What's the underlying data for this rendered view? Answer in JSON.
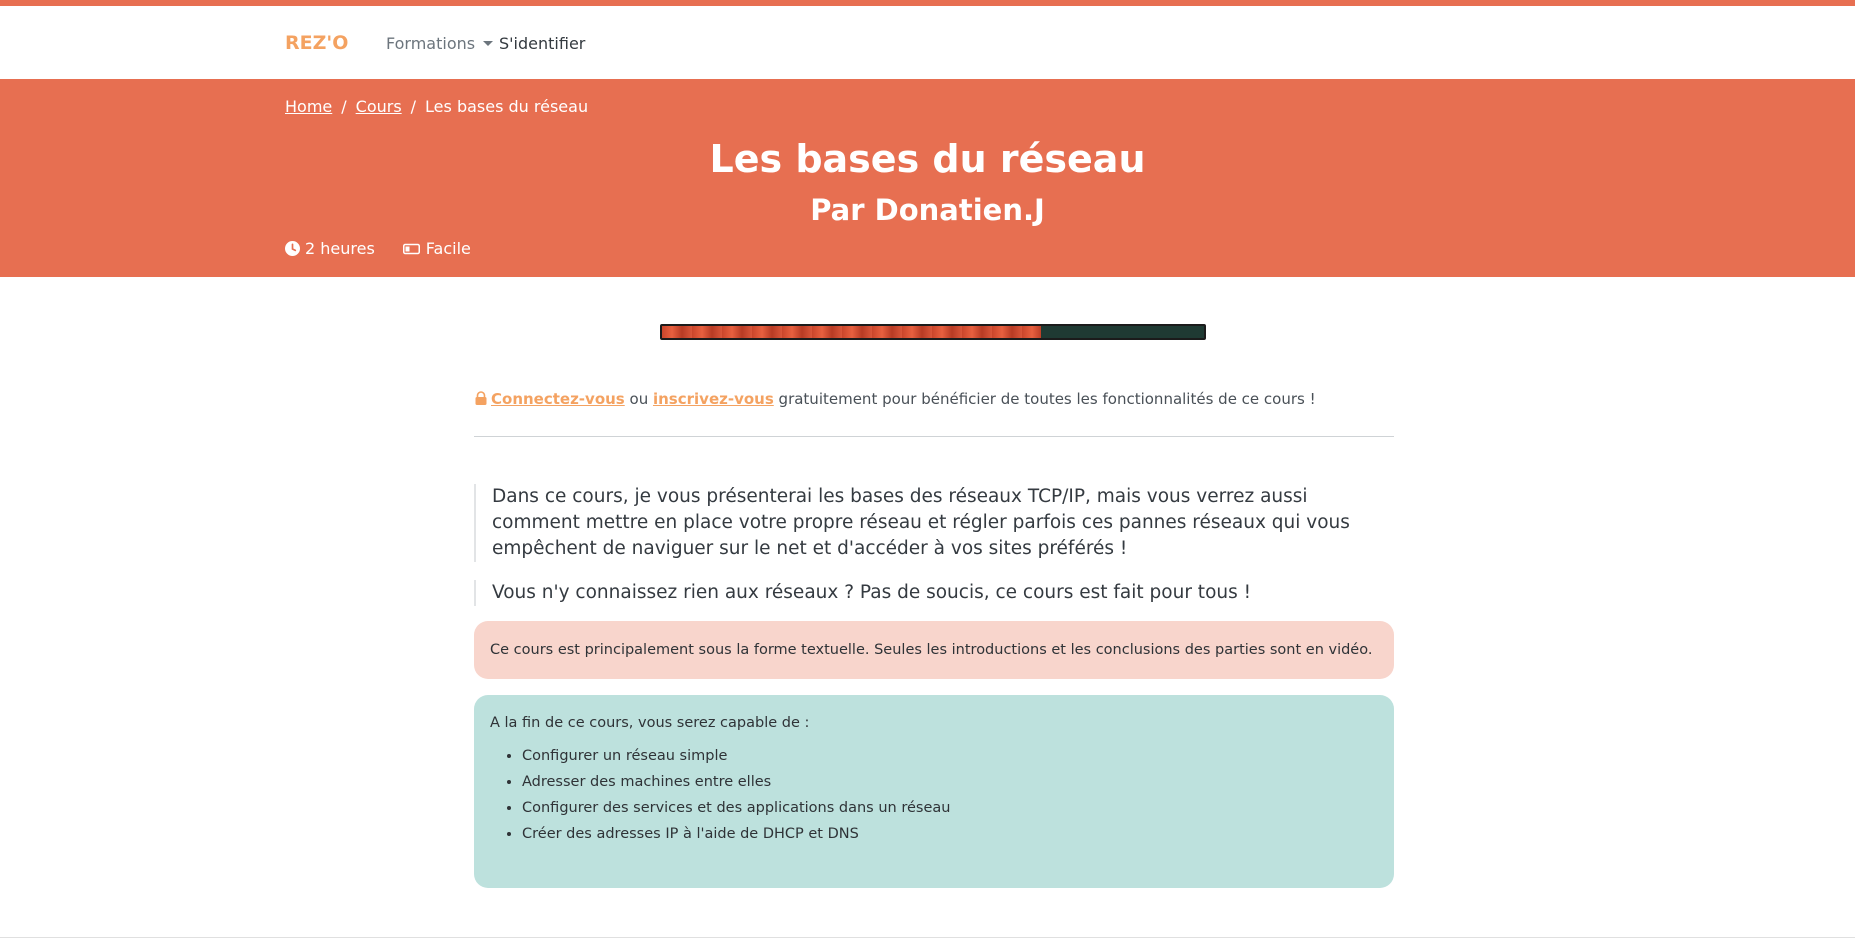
{
  "brand": {
    "logo": "REZ'O",
    "accent": "#e76f51",
    "logo_color": "#f4a261"
  },
  "nav": {
    "formations": "Formations",
    "login": "S'identifier"
  },
  "breadcrumb": {
    "home": "Home",
    "courses": "Cours",
    "current": "Les bases du réseau",
    "separator": "/"
  },
  "course": {
    "title": "Les bases du réseau",
    "author": "Par Donatien.J",
    "duration": "2 heures",
    "difficulty": "Facile",
    "progress_fraction": 0.7
  },
  "notice": {
    "login_link": "Connectez-vous",
    "or": "ou",
    "register_link": "inscrivez-vous",
    "rest": "gratuitement pour bénéficier de toutes les fonctionnalités de ce cours !"
  },
  "intro": {
    "p1": "Dans ce cours, je vous présenterai les bases des réseaux TCP/IP, mais vous verrez aussi comment mettre en place votre propre réseau et régler parfois ces pannes réseaux qui vous empêchent de naviguer sur le net et d'accéder à vos sites préférés !",
    "p2": "Vous n'y connaissez rien aux réseaux ? Pas de soucis, ce cours est fait pour tous !"
  },
  "alerts": {
    "format": "Ce cours est principalement sous la forme textuelle. Seules les introductions et les conclusions des parties sont en vidéo.",
    "objectives_title": "A la fin de ce cours, vous serez capable de :",
    "objectives": [
      "Configurer un réseau simple",
      "Adresser des machines entre elles",
      "Configurer des services et des applications dans un réseau",
      "Créer des adresses IP à l'aide de DHCP et DNS"
    ]
  }
}
